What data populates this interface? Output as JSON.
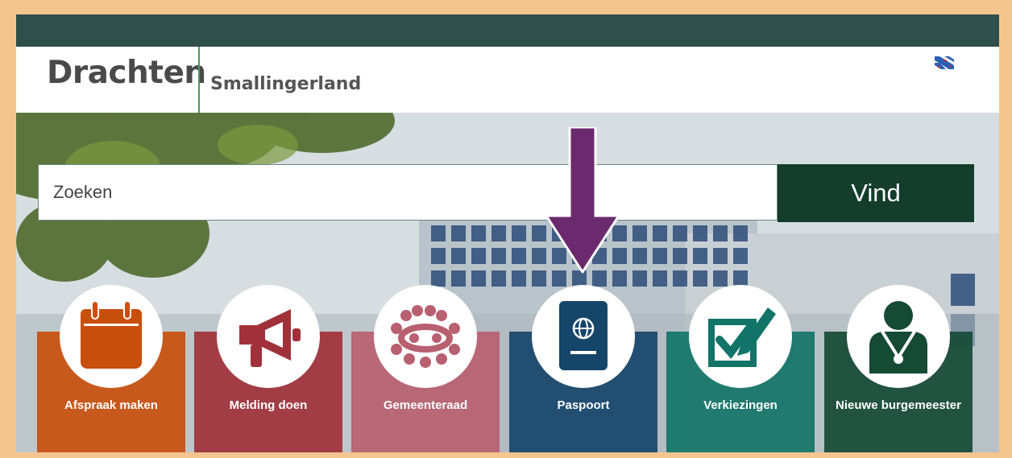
{
  "header": {
    "brand": "Drachten",
    "subtitle": "Smallingerland",
    "flag_icon": "frisian-flag-icon"
  },
  "search": {
    "placeholder": "Zoeken",
    "button_label": "Vind"
  },
  "tiles": [
    {
      "label": "Afspraak maken",
      "icon": "calendar-icon",
      "color": "#c94f0d"
    },
    {
      "label": "Melding doen",
      "icon": "megaphone-icon",
      "color": "#a0313a"
    },
    {
      "label": "Gemeenteraad",
      "icon": "council-icon",
      "color": "#b86070"
    },
    {
      "label": "Paspoort",
      "icon": "passport-icon",
      "color": "#16456a"
    },
    {
      "label": "Verkiezingen",
      "icon": "ballot-icon",
      "color": "#127468"
    },
    {
      "label": "Nieuwe burgemeester",
      "icon": "mayor-icon",
      "color": "#154a35"
    }
  ],
  "colors": {
    "topbar": "#2f4f4b",
    "search_button": "#143d2c",
    "arrow": "#6b2a6e",
    "frame": "#f5c58f"
  }
}
